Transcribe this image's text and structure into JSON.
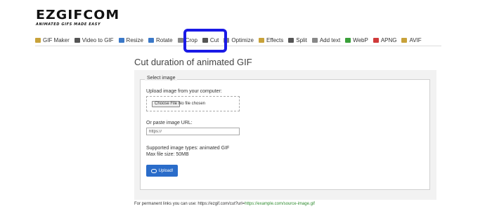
{
  "logo": {
    "main": "EZGIFCOM",
    "sub": "ANIMATED GIFS MADE EASY"
  },
  "nav": {
    "items": [
      {
        "label": "GIF Maker",
        "icon": "gif-maker-icon",
        "color": "#c8a23a"
      },
      {
        "label": "Video to GIF",
        "icon": "video-icon",
        "color": "#555555"
      },
      {
        "label": "Resize",
        "icon": "resize-icon",
        "color": "#3a78c8"
      },
      {
        "label": "Rotate",
        "icon": "rotate-icon",
        "color": "#3a78c8"
      },
      {
        "label": "Crop",
        "icon": "crop-icon",
        "color": "#888888"
      },
      {
        "label": "Cut",
        "icon": "cut-icon",
        "color": "#555555"
      },
      {
        "label": "Optimize",
        "icon": "optimize-icon",
        "color": "#888888"
      },
      {
        "label": "Effects",
        "icon": "effects-icon",
        "color": "#c8a23a"
      },
      {
        "label": "Split",
        "icon": "split-icon",
        "color": "#555555"
      },
      {
        "label": "Add text",
        "icon": "text-icon",
        "color": "#888888"
      },
      {
        "label": "WebP",
        "icon": "webp-icon",
        "color": "#3aa03a"
      },
      {
        "label": "APNG",
        "icon": "apng-icon",
        "color": "#d03a3a"
      },
      {
        "label": "AVIF",
        "icon": "avif-icon",
        "color": "#c8a23a"
      }
    ]
  },
  "main": {
    "title": "Cut duration of animated GIF",
    "legend": "Select image",
    "upload_label": "Upload image from your computer:",
    "choose_file": "Choose File",
    "no_file": "No file chosen",
    "url_label": "Or paste image URL:",
    "url_placeholder": "https://",
    "supported": "Supported image types: animated GIF",
    "max_size": "Max file size: 50MB",
    "upload_button": "Upload!"
  },
  "footer": {
    "prefix": "For permanent links you can use: https://ezgif.com/cut?url=",
    "link": "https://example.com/source-image.gif"
  },
  "colors": {
    "highlight": "#1a1ae6",
    "upload": "#2a6cc9",
    "link": "#2e8b2e"
  }
}
